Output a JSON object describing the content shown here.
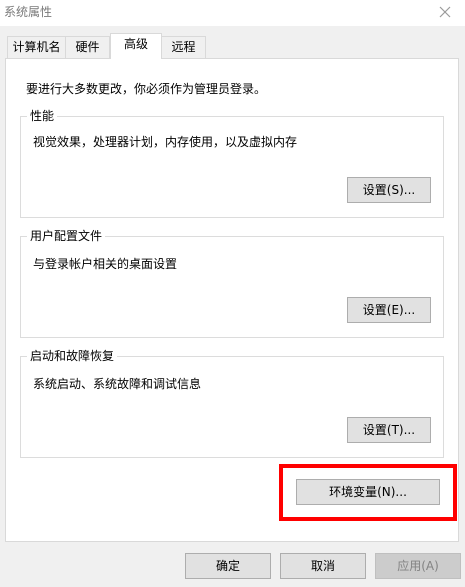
{
  "window": {
    "title": "系统属性"
  },
  "tabs": [
    {
      "label": "计算机名",
      "active": false
    },
    {
      "label": "硬件",
      "active": false
    },
    {
      "label": "高级",
      "active": true
    },
    {
      "label": "远程",
      "active": false
    }
  ],
  "notice": "要进行大多数更改，你必须作为管理员登录。",
  "groups": {
    "performance": {
      "label": "性能",
      "description": "视觉效果，处理器计划，内存使用，以及虚拟内存",
      "button": "设置(S)..."
    },
    "user_profiles": {
      "label": "用户配置文件",
      "description": "与登录帐户相关的桌面设置",
      "button": "设置(E)..."
    },
    "startup_recovery": {
      "label": "启动和故障恢复",
      "description": "系统启动、系统故障和调试信息",
      "button": "设置(T)..."
    }
  },
  "env_button": "环境变量(N)...",
  "footer": {
    "ok": "确定",
    "cancel": "取消",
    "apply": "应用(A)"
  },
  "colors": {
    "highlight": "#ff0000",
    "dialog_bg": "#f0f0f0",
    "button_bg": "#e1e1e1"
  }
}
